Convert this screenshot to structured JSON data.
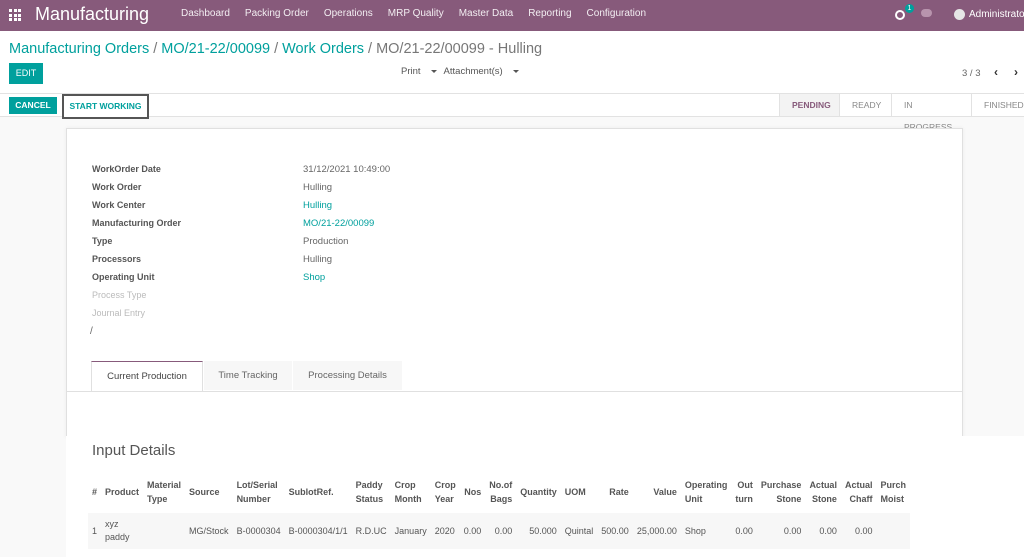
{
  "navbar": {
    "app_name": "Manufacturing",
    "menu": [
      "Dashboard",
      "Packing Order",
      "Operations",
      "MRP Quality",
      "Master Data",
      "Reporting",
      "Configuration"
    ],
    "activity_count": "1",
    "user": "Administrator"
  },
  "breadcrumb": {
    "items": [
      "Manufacturing Orders",
      "MO/21-22/00099",
      "Work Orders"
    ],
    "separator": "/",
    "current": "MO/21-22/00099 - Hulling"
  },
  "toolbar": {
    "edit_label": "EDIT",
    "print_label": "Print",
    "attachments_label": "Attachment(s)",
    "pager": "3 / 3",
    "prev_icon": "‹",
    "next_icon": "›"
  },
  "statusbar": {
    "cancel_label": "CANCEL",
    "start_label": "START WORKING",
    "stages": [
      "PENDING",
      "READY",
      "IN PROGRESS",
      "FINISHED"
    ],
    "active_stage": "PENDING"
  },
  "form": {
    "fields": [
      {
        "label": "WorkOrder Date",
        "value": "31/12/2021 10:49:00",
        "link": false
      },
      {
        "label": "Work Order",
        "value": "Hulling",
        "link": false
      },
      {
        "label": "Work Center",
        "value": "Hulling",
        "link": true
      },
      {
        "label": "Manufacturing Order",
        "value": "MO/21-22/00099",
        "link": true
      },
      {
        "label": "Type",
        "value": "Production",
        "link": false
      },
      {
        "label": "Processors",
        "value": "Hulling",
        "link": false
      },
      {
        "label": "Operating Unit",
        "value": "Shop",
        "link": true
      },
      {
        "label": "Process Type",
        "value": "",
        "link": false
      },
      {
        "label": "Journal Entry",
        "value": "",
        "link": false
      }
    ],
    "trailing_text": "/"
  },
  "tabs": [
    "Current Production",
    "Time Tracking",
    "Processing Details"
  ],
  "input_details": {
    "title": "Input Details",
    "columns": [
      "#",
      "Product",
      "Material\nType",
      "Source",
      "Lot/Serial\nNumber",
      "SublotRef.",
      "Paddy\nStatus",
      "Crop\nMonth",
      "Crop\nYear",
      "Nos",
      "No.of\nBags",
      "Quantity",
      "UOM",
      "Rate",
      "Value",
      "Operating\nUnit",
      "Out\nturn",
      "Purchase\nStone",
      "Actual\nStone",
      "Actual\nChaff",
      "Purch\nMoist"
    ],
    "rows": [
      [
        "1",
        "xyz\npaddy",
        "",
        "MG/Stock",
        "B-0000304",
        "B-0000304/1/1",
        "R.D.UC",
        "January",
        "2020",
        "0.00",
        "0.00",
        "50.000",
        "Quintal",
        "500.00",
        "25,000.00",
        "Shop",
        "0.00",
        "0.00",
        "0.00",
        "0.00",
        ""
      ]
    ]
  }
}
